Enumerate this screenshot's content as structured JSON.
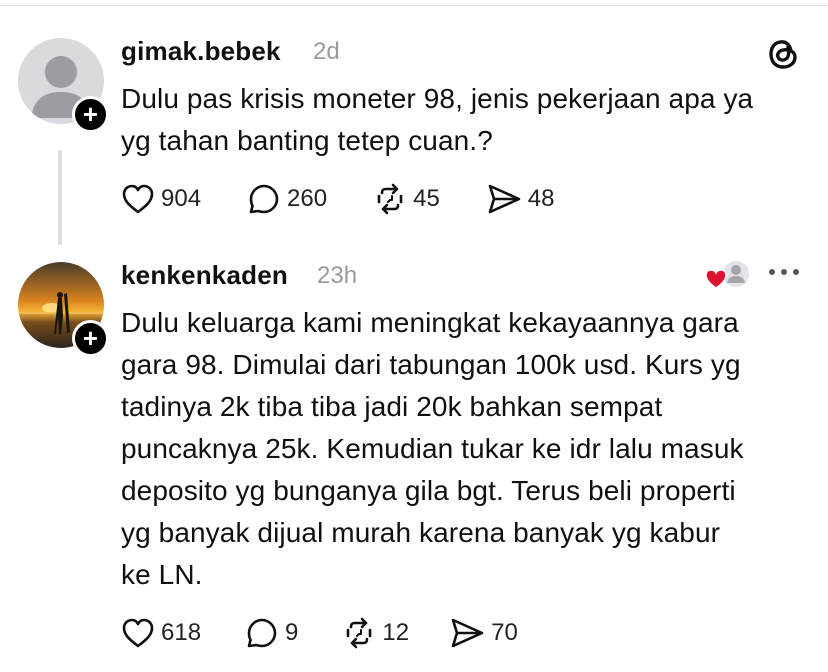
{
  "posts": [
    {
      "username": "gimak.bebek",
      "time": "2d",
      "text": "Dulu pas krisis moneter 98, jenis pekerjaan apa ya\nyg tahan banting tetep cuan.?",
      "likes": "904",
      "replies": "260",
      "reposts": "45",
      "shares": "48"
    },
    {
      "username": "kenkenkaden",
      "time": "23h",
      "text": "Dulu keluarga kami meningkat kekayaannya gara\ngara 98. Dimulai dari tabungan 100k usd. Kurs yg\ntadinya 2k tiba tiba jadi 20k bahkan sempat\npuncaknya 25k. Kemudian tukar ke idr lalu masuk\ndeposito yg bunganya gila bgt. Terus beli properti\nyg banyak dijual murah karena banyak yg kabur\nke LN.",
      "likes": "618",
      "replies": "9",
      "reposts": "12",
      "shares": "70"
    }
  ],
  "icons": {
    "threads_logo": "threads-logo-icon",
    "like": "heart-icon",
    "reply": "comment-icon",
    "repost": "repost-icon",
    "share": "share-icon",
    "more": "more-icon",
    "liked_by_author": "liked-by-author-icon",
    "follow": "plus-icon"
  },
  "colors": {
    "text": "#101010",
    "muted": "#9a9a9a",
    "heart_red": "#e0112e",
    "thread_line": "#dcdcdc"
  }
}
